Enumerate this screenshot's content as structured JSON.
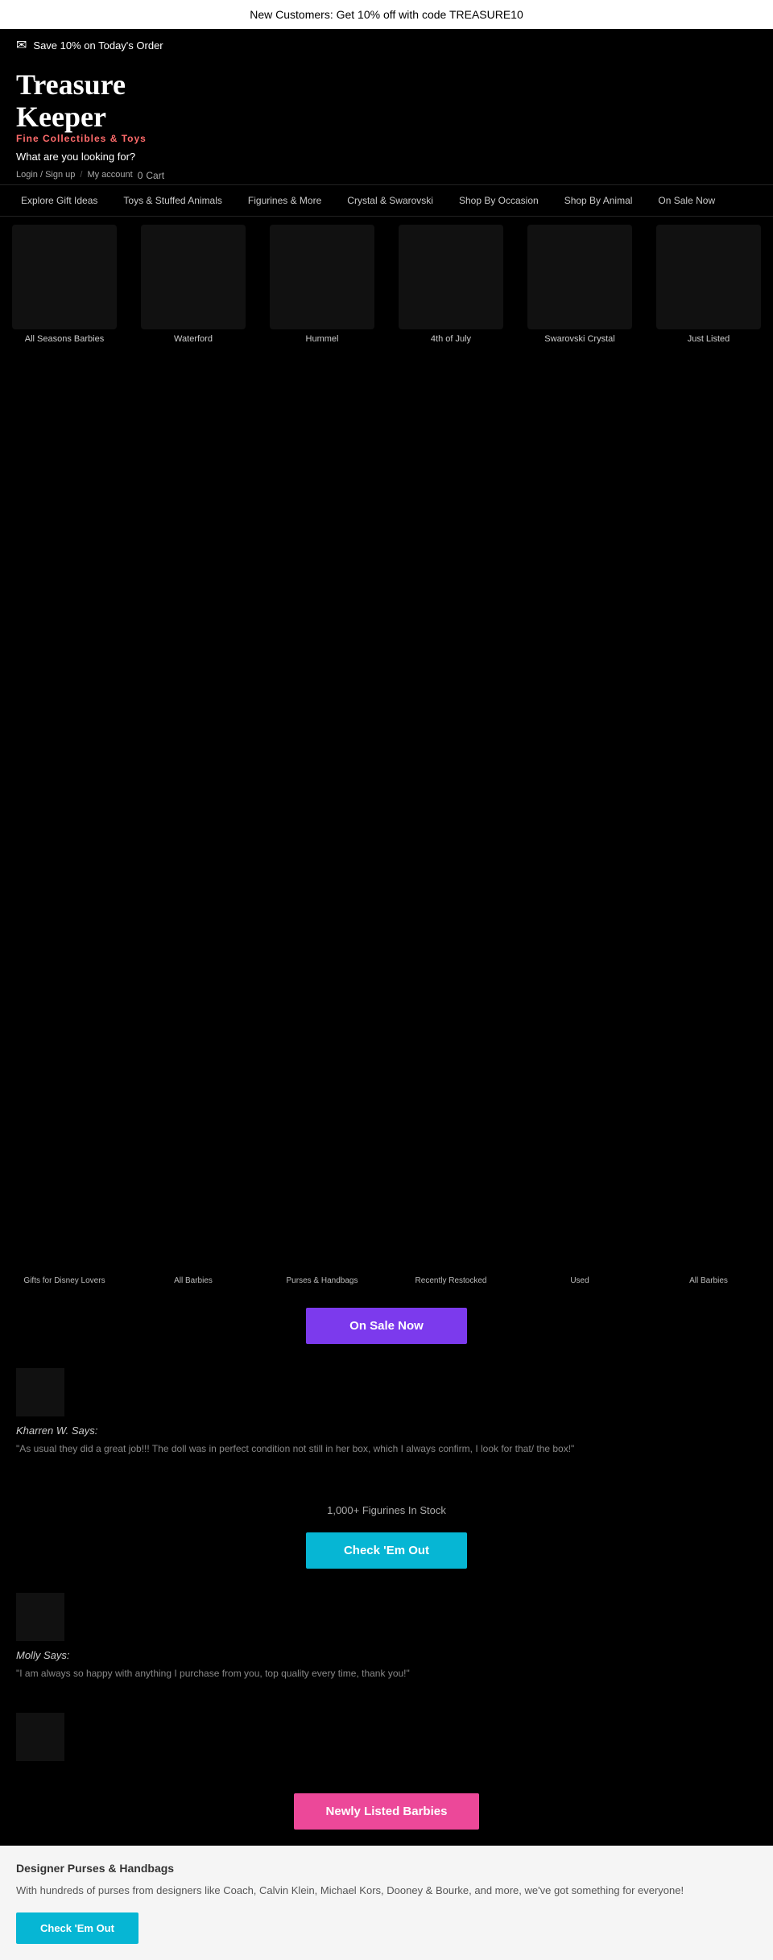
{
  "announcement": {
    "text": "New Customers: Get 10% off with code TREASURE10"
  },
  "email_bar": {
    "icon": "✉",
    "text": "Save 10% on Today's Order"
  },
  "brand": {
    "title_line1": "Treasure",
    "title_line2": "Keeper",
    "subtitle": "Fine Collectibles & Toys",
    "search_label": "What are you looking for?"
  },
  "nav_links": [
    {
      "label": "Login / Sign up",
      "id": "login"
    },
    {
      "label": "My account",
      "id": "account"
    },
    {
      "label": "0",
      "id": "cart-count"
    },
    {
      "label": "Cart",
      "id": "cart"
    }
  ],
  "main_nav": {
    "items": [
      "Explore Gift Ideas",
      "Toys & Stuffed Animals",
      "Figurines & More",
      "Crystal & Swarovski",
      "Shop By Occasion",
      "Shop By Animal",
      "On Sale Now"
    ]
  },
  "categories": {
    "row1": [
      {
        "label": "All Seasons Barbies",
        "img": ""
      },
      {
        "label": "Waterford",
        "img": ""
      },
      {
        "label": "Hummel",
        "img": ""
      },
      {
        "label": "4th of July",
        "img": ""
      },
      {
        "label": "Swarovski Crystal",
        "img": ""
      },
      {
        "label": "Just Listed",
        "img": ""
      }
    ]
  },
  "bottom_labels": [
    "Gifts for Disney Lovers",
    "All Barbies",
    "Purses & Handbags",
    "Recently Restocked",
    "Used",
    "All Barbies"
  ],
  "cta_buttons": {
    "sale": "On Sale Now",
    "check_em_out": "Check 'Em Out",
    "newly_listed": "Newly Listed Barbies",
    "footer_check": "Check 'Em Out"
  },
  "reviews": {
    "review1": {
      "name": "Kharren W. Says:",
      "text": "\"As usual they did a great job!!! The doll was in perfect condition not still in her box, which I always confirm, I look for that/ the box!\""
    },
    "review2": {
      "name": "Molly Says:",
      "text": "\"I am always so happy with anything I purchase from you, top quality every time, thank you!\""
    }
  },
  "stock": {
    "text": "1,000+ Figurines In Stock"
  },
  "footer": {
    "title": "Designer Purses & Handbags",
    "text": "With hundreds of purses from designers like Coach, Calvin Klein, Michael Kors, Dooney & Bourke, and more, we've got something for everyone!",
    "button": "Check 'Em Out"
  }
}
